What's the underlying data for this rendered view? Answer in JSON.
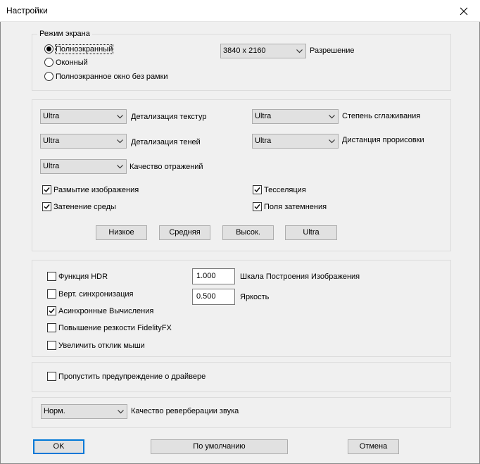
{
  "window": {
    "title": "Настройки"
  },
  "screen_mode": {
    "title": "Режим экрана",
    "options": [
      {
        "label": "Полноэкранный",
        "selected": true
      },
      {
        "label": "Оконный",
        "selected": false
      },
      {
        "label": "Полноэкранное окно без рамки",
        "selected": false
      }
    ],
    "resolution": {
      "value": "3840 x 2160",
      "label": "Разрешение"
    }
  },
  "graphics": {
    "combos": [
      {
        "value": "Ultra",
        "label": "Детализация текстур"
      },
      {
        "value": "Ultra",
        "label": "Степень сглаживания"
      },
      {
        "value": "Ultra",
        "label": "Детализация теней"
      },
      {
        "value": "Ultra",
        "label": "Дистанция прорисовки"
      },
      {
        "value": "Ultra",
        "label": "Качество отражений"
      }
    ],
    "checkboxes": [
      {
        "label": "Размытие изображения",
        "checked": true
      },
      {
        "label": "Тесселяция",
        "checked": true
      },
      {
        "label": "Затенение среды",
        "checked": true
      },
      {
        "label": "Поля затемнения",
        "checked": true
      }
    ],
    "presets": [
      "Низкое",
      "Средняя",
      "Высок.",
      "Ultra"
    ]
  },
  "advanced": {
    "checkboxes": [
      {
        "label": "Функция HDR",
        "checked": false
      },
      {
        "label": "Верт. синхронизация",
        "checked": false
      },
      {
        "label": "Асинхронные Вычисления",
        "checked": true
      },
      {
        "label": "Повышение резкости FidelityFX",
        "checked": false
      },
      {
        "label": "Увеличить отклик мыши",
        "checked": false
      }
    ],
    "fields": [
      {
        "value": "1.000",
        "label": "Шкала Построения Изображения"
      },
      {
        "value": "0.500",
        "label": "Яркость"
      }
    ]
  },
  "driver": {
    "label": "Пропустить предупреждение о драйвере",
    "checked": false
  },
  "audio": {
    "value": "Норм.",
    "label": "Качество реверберации звука"
  },
  "footer": {
    "ok": "OK",
    "defaults": "По умолчанию",
    "cancel": "Отмена"
  }
}
